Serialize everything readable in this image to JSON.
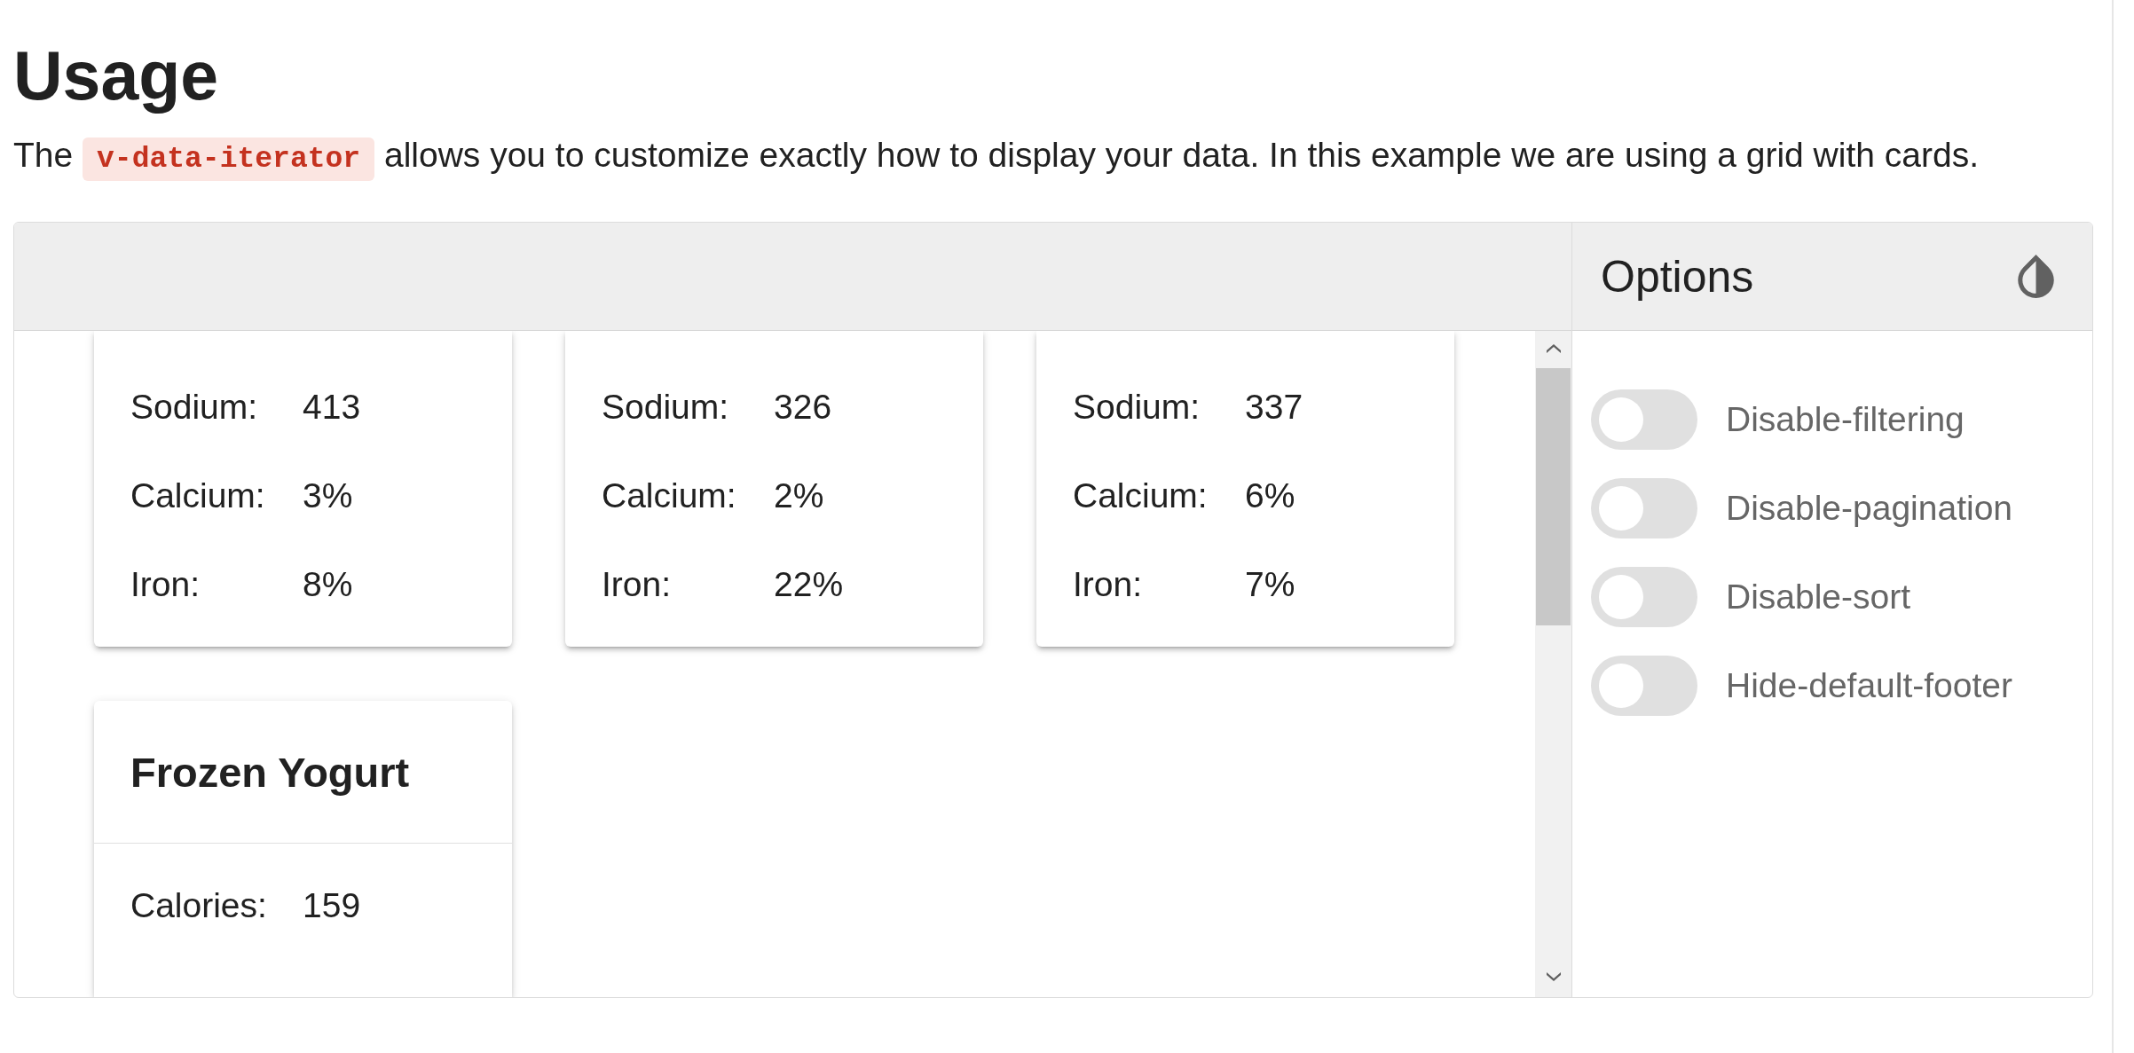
{
  "heading": "Usage",
  "intro": {
    "before": "The",
    "code": "v-data-iterator",
    "after": "allows you to customize exactly how to display your data. In this example we are using a grid with cards."
  },
  "example": {
    "cards": [
      {
        "rows": [
          {
            "label": "Sodium:",
            "value": "413"
          },
          {
            "label": "Calcium:",
            "value": "3%"
          },
          {
            "label": "Iron:",
            "value": "8%"
          }
        ]
      },
      {
        "rows": [
          {
            "label": "Sodium:",
            "value": "326"
          },
          {
            "label": "Calcium:",
            "value": "2%"
          },
          {
            "label": "Iron:",
            "value": "22%"
          }
        ]
      },
      {
        "rows": [
          {
            "label": "Sodium:",
            "value": "337"
          },
          {
            "label": "Calcium:",
            "value": "6%"
          },
          {
            "label": "Iron:",
            "value": "7%"
          }
        ]
      },
      {
        "title": "Frozen Yogurt",
        "rows": [
          {
            "label": "Calories:",
            "value": "159"
          }
        ]
      }
    ],
    "options": {
      "title": "Options",
      "switches": [
        {
          "label": "Disable-filtering",
          "on": false
        },
        {
          "label": "Disable-pagination",
          "on": false
        },
        {
          "label": "Disable-sort",
          "on": false
        },
        {
          "label": "Hide-default-footer",
          "on": false
        }
      ]
    }
  }
}
